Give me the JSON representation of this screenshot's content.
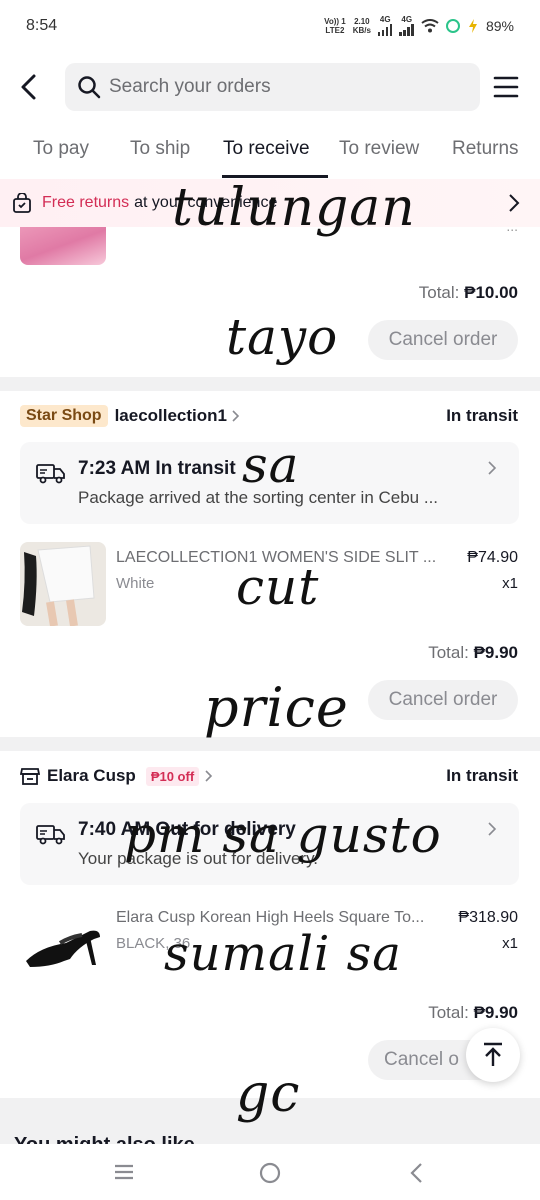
{
  "status_bar": {
    "time": "8:54",
    "volte": "Vo)) 1",
    "lte": "LTE2",
    "speed": "2.10",
    "speed_unit": "KB/s",
    "net1": "4G",
    "net2": "4G",
    "battery": "89%"
  },
  "search": {
    "placeholder": "Search your orders"
  },
  "tabs": [
    "To pay",
    "To ship",
    "To receive",
    "To review",
    "Returns"
  ],
  "active_tab": "To receive",
  "banner": {
    "highlight": "Free returns",
    "rest": "at your convenience"
  },
  "order1": {
    "total_label": "Total:",
    "total_value": "₱10.00",
    "cancel_label": "Cancel order"
  },
  "order2": {
    "badge": "Star Shop",
    "shop": "laecollection1",
    "status": "In transit",
    "tracking_title": "7:23 AM In transit",
    "tracking_detail": "Package arrived at the sorting center in Cebu ...",
    "product_name": "LAECOLLECTION1 WOMEN'S  SIDE SLIT ...",
    "variant": "White",
    "price": "₱74.90",
    "qty": "x1",
    "total_label": "Total:",
    "total_value": "₱9.90",
    "cancel_label": "Cancel order"
  },
  "order3": {
    "shop": "Elara Cusp",
    "discount": "₱10 off",
    "status": "In transit",
    "tracking_title": "7:40 AM Out for delivery",
    "tracking_detail": "Your package is out for delivery.",
    "product_name": "Elara Cusp Korean High Heels Square To...",
    "variant": "BLACK, 36",
    "price": "₱318.90",
    "qty": "x1",
    "total_label": "Total:",
    "total_value": "₱9.90",
    "cancel_label": "Cancel o"
  },
  "suggest_title": "You might also like",
  "overlay_text": [
    "tulungan",
    "tayo",
    "sa",
    "cut",
    "price",
    "pm sa gusto",
    "sumali sa",
    "gc"
  ]
}
